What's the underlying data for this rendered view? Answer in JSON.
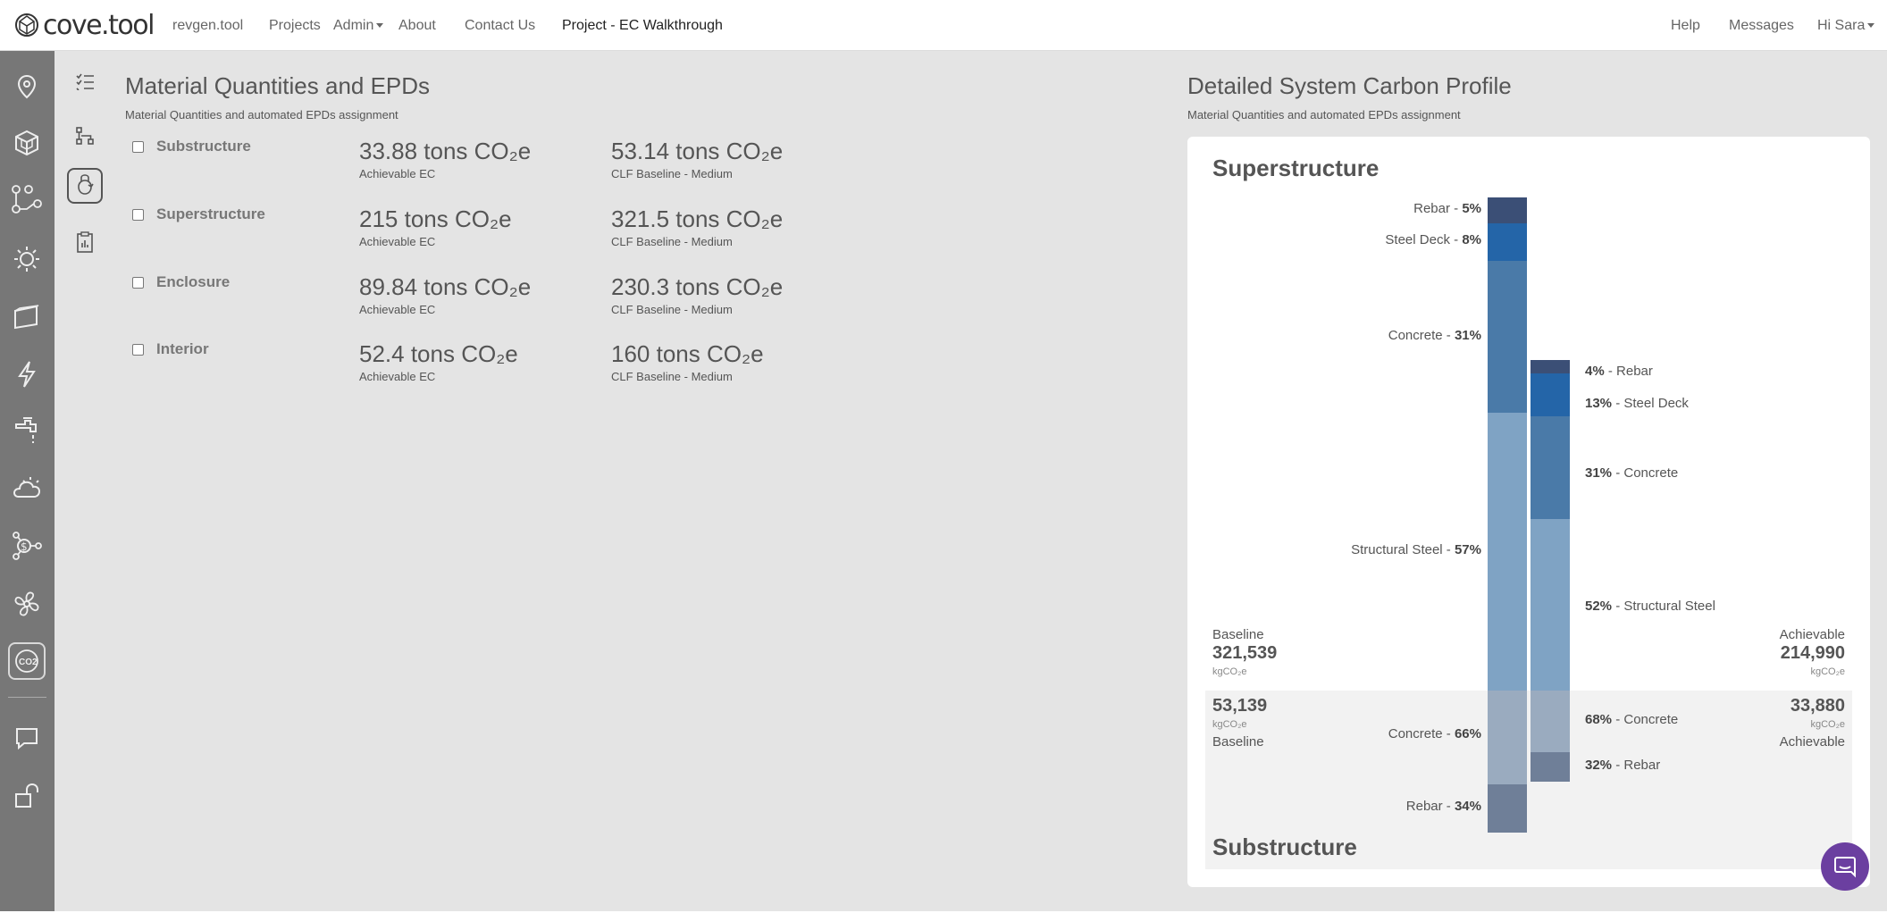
{
  "nav": {
    "logo": "cove.tool",
    "links": [
      "revgen.tool",
      "Projects",
      "Admin",
      "About",
      "Contact Us",
      "Project - EC Walkthrough"
    ],
    "right": [
      "Help",
      "Messages",
      "Hi Sara"
    ]
  },
  "sidebar": {
    "items": [
      "location-pin-icon",
      "cube-icon",
      "network-icon",
      "sun-icon",
      "panel-icon",
      "lightning-icon",
      "faucet-icon",
      "cloud-sun-icon",
      "cost-network-icon",
      "fan-icon",
      "co2-icon",
      "chat-icon",
      "unlock-icon"
    ],
    "active": "co2-icon",
    "co2_text": "CO2"
  },
  "subnav": {
    "items": [
      "checklist-icon",
      "hierarchy-icon",
      "refresh-building-icon",
      "clipboard-icon"
    ],
    "active": "refresh-building-icon"
  },
  "left_panel": {
    "title": "Material Quantities and EPDs",
    "subtitle": "Material Quantities and automated EPDs assignment",
    "rows": [
      {
        "name": "Substructure",
        "achievable": "33.88 tons CO₂e",
        "achievable_label": "Achievable EC",
        "baseline": "53.14 tons CO₂e",
        "baseline_label": "CLF Baseline - Medium"
      },
      {
        "name": "Superstructure",
        "achievable": "215 tons CO₂e",
        "achievable_label": "Achievable EC",
        "baseline": "321.5 tons CO₂e",
        "baseline_label": "CLF Baseline - Medium"
      },
      {
        "name": "Enclosure",
        "achievable": "89.84 tons CO₂e",
        "achievable_label": "Achievable EC",
        "baseline": "230.3 tons CO₂e",
        "baseline_label": "CLF Baseline - Medium"
      },
      {
        "name": "Interior",
        "achievable": "52.4 tons CO₂e",
        "achievable_label": "Achievable EC",
        "baseline": "160 tons CO₂e",
        "baseline_label": "CLF Baseline - Medium"
      }
    ]
  },
  "right_panel": {
    "title": "Detailed System Carbon Profile",
    "subtitle": "Material Quantities and automated EPDs assignment",
    "superstructure": {
      "heading": "Superstructure",
      "baseline_label": "Baseline",
      "baseline_value": "321,539",
      "achievable_label": "Achievable",
      "achievable_value": "214,990",
      "unit": "kgCO₂e",
      "baseline_segments": [
        {
          "name": "Rebar",
          "pct": "5%",
          "color": "#3b4f76"
        },
        {
          "name": "Steel Deck",
          "pct": "8%",
          "color": "#2465a8"
        },
        {
          "name": "Concrete",
          "pct": "31%",
          "color": "#4a7aa8"
        },
        {
          "name": "Structural Steel",
          "pct": "57%",
          "color": "#7fa3c4"
        }
      ],
      "achievable_segments": [
        {
          "name": "Rebar",
          "pct": "4%",
          "color": "#3b4f76"
        },
        {
          "name": "Steel Deck",
          "pct": "13%",
          "color": "#2465a8"
        },
        {
          "name": "Concrete",
          "pct": "31%",
          "color": "#4a7aa8"
        },
        {
          "name": "Structural Steel",
          "pct": "52%",
          "color": "#7fa3c4"
        }
      ]
    },
    "substructure": {
      "heading": "Substructure",
      "baseline_label": "Baseline",
      "baseline_value": "53,139",
      "achievable_label": "Achievable",
      "achievable_value": "33,880",
      "unit": "kgCO₂e",
      "baseline_segments": [
        {
          "name": "Concrete",
          "pct": "66%",
          "color": "#9aabbf"
        },
        {
          "name": "Rebar",
          "pct": "34%",
          "color": "#6f7f98"
        }
      ],
      "achievable_segments": [
        {
          "name": "Concrete",
          "pct": "68%",
          "color": "#9aabbf"
        },
        {
          "name": "Rebar",
          "pct": "32%",
          "color": "#6f7f98"
        }
      ]
    }
  },
  "chat_widget": "chat-bubble-icon"
}
